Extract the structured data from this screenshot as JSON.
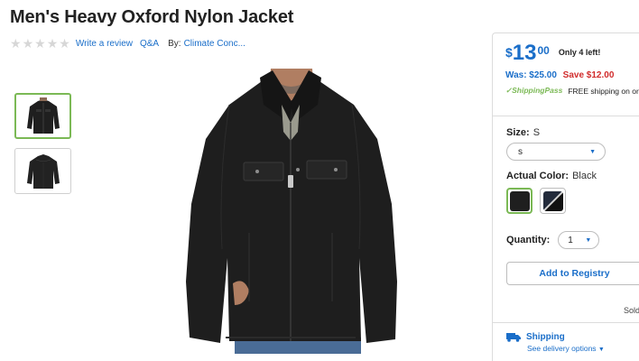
{
  "product": {
    "title": "Men's Heavy Oxford Nylon Jacket",
    "rating_stars": 5,
    "write_review": "Write a review",
    "qa": "Q&A",
    "by_label": "By:",
    "brand": "Climate Conc..."
  },
  "thumbnails": [
    {
      "icon": "jacket-front-thumbnail"
    },
    {
      "icon": "jacket-back-thumbnail"
    }
  ],
  "price": {
    "currency": "$",
    "dollars": "13",
    "cents": "00",
    "stock_note": "Only 4 left!",
    "was": "Was: $25.00",
    "save": "Save $12.00",
    "shipping_pass": "ShippingPass",
    "free_shipping": "FREE shipping on orders"
  },
  "options": {
    "size_label": "Size:",
    "size_value": "S",
    "size_select_value": "s",
    "color_label": "Actual Color:",
    "color_value": "Black",
    "quantity_label": "Quantity:",
    "quantity_value": "1",
    "add_to_registry": "Add to Registry",
    "sold": "Sold"
  },
  "shipping": {
    "title": "Shipping",
    "delivery_options": "See delivery options"
  },
  "colors": {
    "accent_blue": "#1a6ec9",
    "save_red": "#d12c2c",
    "selected_green": "#7bb955"
  }
}
